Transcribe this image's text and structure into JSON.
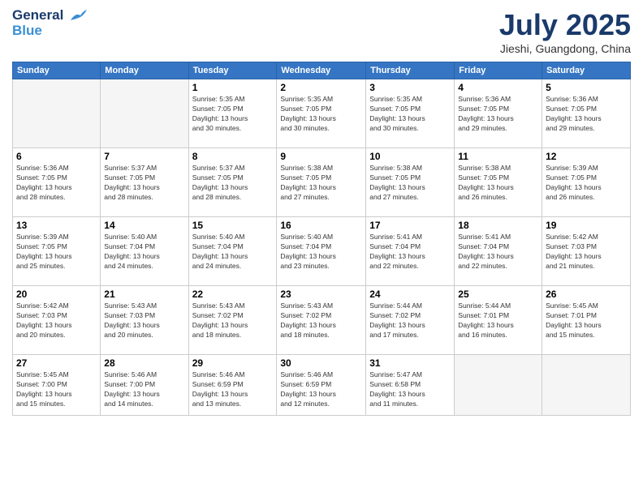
{
  "header": {
    "logo_line1": "General",
    "logo_line2": "Blue",
    "month_title": "July 2025",
    "location": "Jieshi, Guangdong, China"
  },
  "weekdays": [
    "Sunday",
    "Monday",
    "Tuesday",
    "Wednesday",
    "Thursday",
    "Friday",
    "Saturday"
  ],
  "weeks": [
    [
      {
        "day": "",
        "info": ""
      },
      {
        "day": "",
        "info": ""
      },
      {
        "day": "1",
        "info": "Sunrise: 5:35 AM\nSunset: 7:05 PM\nDaylight: 13 hours\nand 30 minutes."
      },
      {
        "day": "2",
        "info": "Sunrise: 5:35 AM\nSunset: 7:05 PM\nDaylight: 13 hours\nand 30 minutes."
      },
      {
        "day": "3",
        "info": "Sunrise: 5:35 AM\nSunset: 7:05 PM\nDaylight: 13 hours\nand 30 minutes."
      },
      {
        "day": "4",
        "info": "Sunrise: 5:36 AM\nSunset: 7:05 PM\nDaylight: 13 hours\nand 29 minutes."
      },
      {
        "day": "5",
        "info": "Sunrise: 5:36 AM\nSunset: 7:05 PM\nDaylight: 13 hours\nand 29 minutes."
      }
    ],
    [
      {
        "day": "6",
        "info": "Sunrise: 5:36 AM\nSunset: 7:05 PM\nDaylight: 13 hours\nand 28 minutes."
      },
      {
        "day": "7",
        "info": "Sunrise: 5:37 AM\nSunset: 7:05 PM\nDaylight: 13 hours\nand 28 minutes."
      },
      {
        "day": "8",
        "info": "Sunrise: 5:37 AM\nSunset: 7:05 PM\nDaylight: 13 hours\nand 28 minutes."
      },
      {
        "day": "9",
        "info": "Sunrise: 5:38 AM\nSunset: 7:05 PM\nDaylight: 13 hours\nand 27 minutes."
      },
      {
        "day": "10",
        "info": "Sunrise: 5:38 AM\nSunset: 7:05 PM\nDaylight: 13 hours\nand 27 minutes."
      },
      {
        "day": "11",
        "info": "Sunrise: 5:38 AM\nSunset: 7:05 PM\nDaylight: 13 hours\nand 26 minutes."
      },
      {
        "day": "12",
        "info": "Sunrise: 5:39 AM\nSunset: 7:05 PM\nDaylight: 13 hours\nand 26 minutes."
      }
    ],
    [
      {
        "day": "13",
        "info": "Sunrise: 5:39 AM\nSunset: 7:05 PM\nDaylight: 13 hours\nand 25 minutes."
      },
      {
        "day": "14",
        "info": "Sunrise: 5:40 AM\nSunset: 7:04 PM\nDaylight: 13 hours\nand 24 minutes."
      },
      {
        "day": "15",
        "info": "Sunrise: 5:40 AM\nSunset: 7:04 PM\nDaylight: 13 hours\nand 24 minutes."
      },
      {
        "day": "16",
        "info": "Sunrise: 5:40 AM\nSunset: 7:04 PM\nDaylight: 13 hours\nand 23 minutes."
      },
      {
        "day": "17",
        "info": "Sunrise: 5:41 AM\nSunset: 7:04 PM\nDaylight: 13 hours\nand 22 minutes."
      },
      {
        "day": "18",
        "info": "Sunrise: 5:41 AM\nSunset: 7:04 PM\nDaylight: 13 hours\nand 22 minutes."
      },
      {
        "day": "19",
        "info": "Sunrise: 5:42 AM\nSunset: 7:03 PM\nDaylight: 13 hours\nand 21 minutes."
      }
    ],
    [
      {
        "day": "20",
        "info": "Sunrise: 5:42 AM\nSunset: 7:03 PM\nDaylight: 13 hours\nand 20 minutes."
      },
      {
        "day": "21",
        "info": "Sunrise: 5:43 AM\nSunset: 7:03 PM\nDaylight: 13 hours\nand 20 minutes."
      },
      {
        "day": "22",
        "info": "Sunrise: 5:43 AM\nSunset: 7:02 PM\nDaylight: 13 hours\nand 18 minutes."
      },
      {
        "day": "23",
        "info": "Sunrise: 5:43 AM\nSunset: 7:02 PM\nDaylight: 13 hours\nand 18 minutes."
      },
      {
        "day": "24",
        "info": "Sunrise: 5:44 AM\nSunset: 7:02 PM\nDaylight: 13 hours\nand 17 minutes."
      },
      {
        "day": "25",
        "info": "Sunrise: 5:44 AM\nSunset: 7:01 PM\nDaylight: 13 hours\nand 16 minutes."
      },
      {
        "day": "26",
        "info": "Sunrise: 5:45 AM\nSunset: 7:01 PM\nDaylight: 13 hours\nand 15 minutes."
      }
    ],
    [
      {
        "day": "27",
        "info": "Sunrise: 5:45 AM\nSunset: 7:00 PM\nDaylight: 13 hours\nand 15 minutes."
      },
      {
        "day": "28",
        "info": "Sunrise: 5:46 AM\nSunset: 7:00 PM\nDaylight: 13 hours\nand 14 minutes."
      },
      {
        "day": "29",
        "info": "Sunrise: 5:46 AM\nSunset: 6:59 PM\nDaylight: 13 hours\nand 13 minutes."
      },
      {
        "day": "30",
        "info": "Sunrise: 5:46 AM\nSunset: 6:59 PM\nDaylight: 13 hours\nand 12 minutes."
      },
      {
        "day": "31",
        "info": "Sunrise: 5:47 AM\nSunset: 6:58 PM\nDaylight: 13 hours\nand 11 minutes."
      },
      {
        "day": "",
        "info": ""
      },
      {
        "day": "",
        "info": ""
      }
    ]
  ]
}
